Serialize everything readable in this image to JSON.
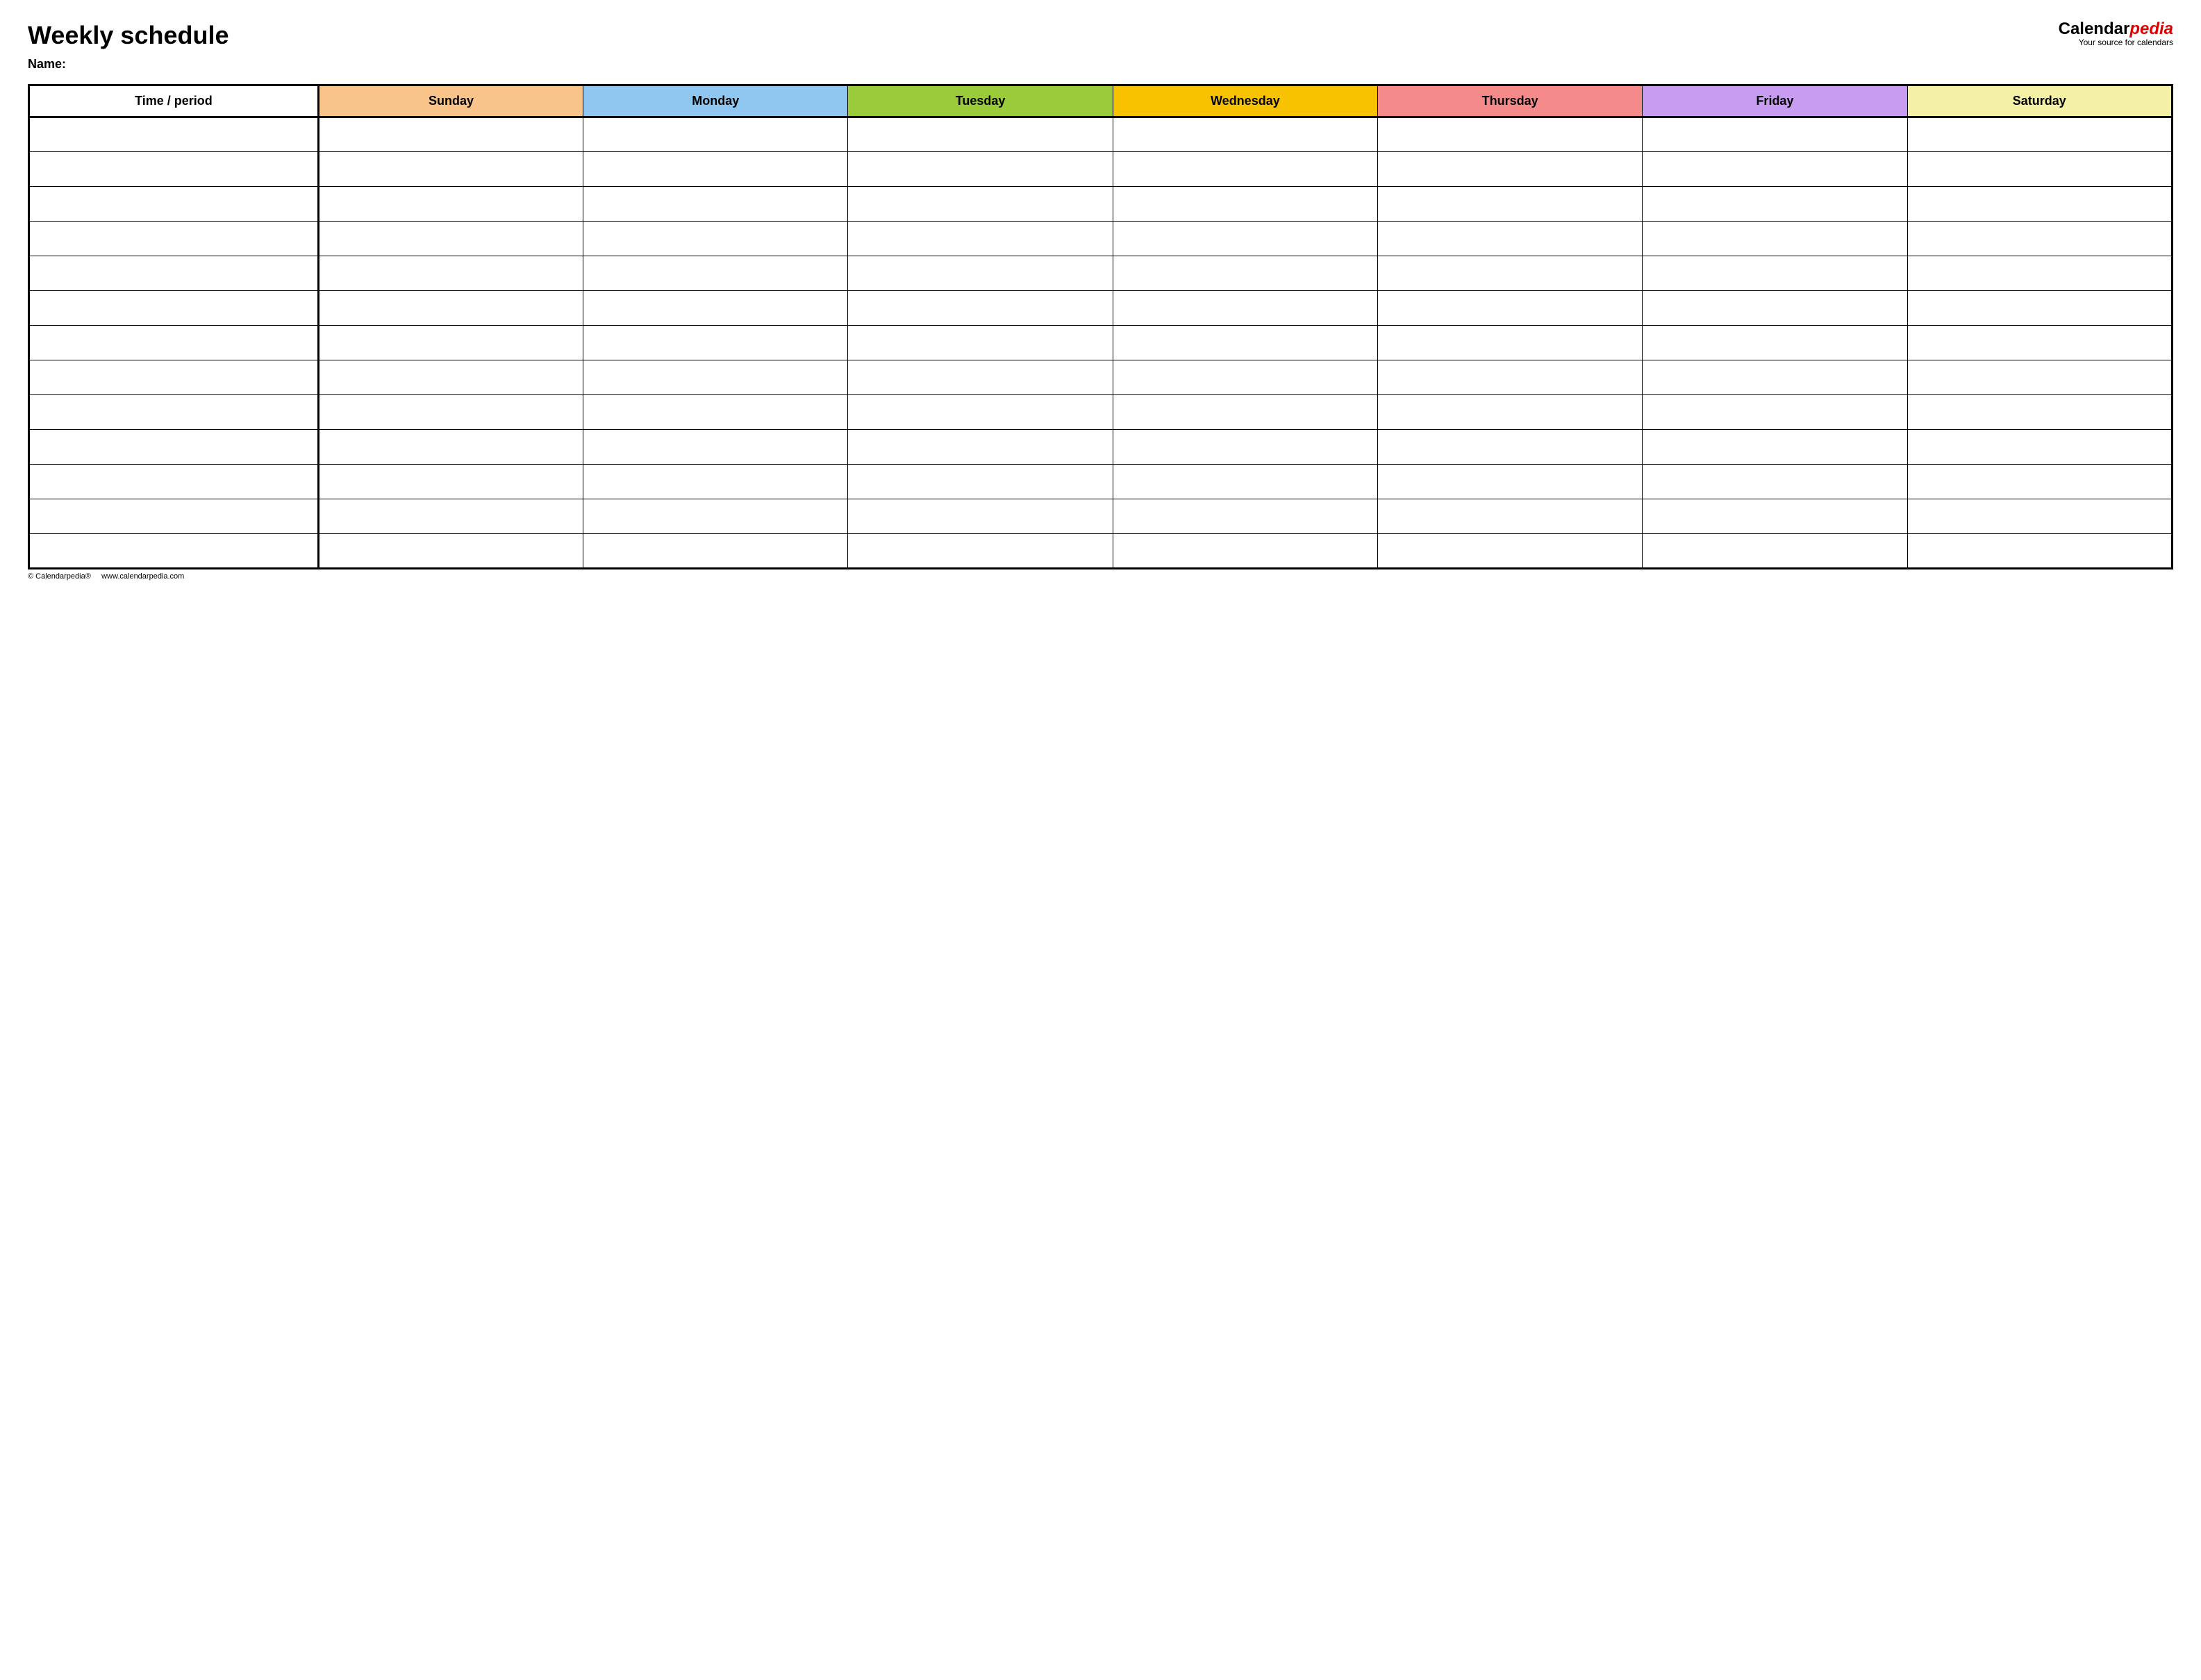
{
  "title": "Weekly schedule",
  "name_label": "Name:",
  "brand": {
    "part1": "Calendar",
    "part2": "pedia",
    "tagline": "Your source for calendars"
  },
  "columns": {
    "time": "Time / period",
    "days": [
      {
        "label": "Sunday",
        "color": "#f9c48a"
      },
      {
        "label": "Monday",
        "color": "#8fc7f1"
      },
      {
        "label": "Tuesday",
        "color": "#9acb3b"
      },
      {
        "label": "Wednesday",
        "color": "#f7c300"
      },
      {
        "label": "Thursday",
        "color": "#f48a8a"
      },
      {
        "label": "Friday",
        "color": "#c89cf0"
      },
      {
        "label": "Saturday",
        "color": "#f4f1a6"
      }
    ]
  },
  "row_count": 13,
  "footer": {
    "copyright": "© Calendarpedia®",
    "url": "www.calendarpedia.com"
  }
}
